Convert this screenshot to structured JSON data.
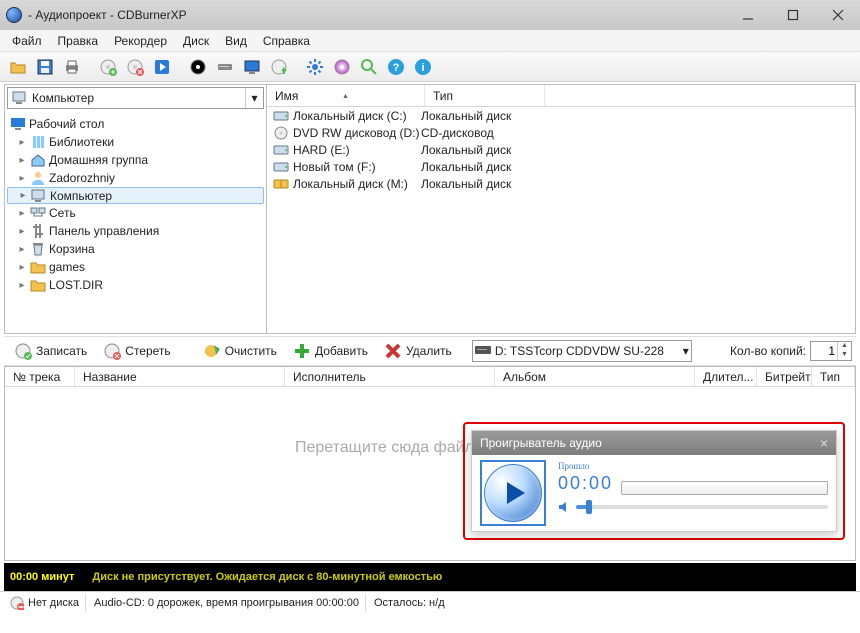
{
  "window": {
    "title": "- Аудиопроект - CDBurnerXP"
  },
  "menu": [
    "Файл",
    "Правка",
    "Рекордер",
    "Диск",
    "Вид",
    "Справка"
  ],
  "combo": {
    "label": "Компьютер"
  },
  "tree": {
    "root": "Рабочий стол",
    "items": [
      {
        "label": "Библиотеки",
        "kind": "lib"
      },
      {
        "label": "Домашняя группа",
        "kind": "home"
      },
      {
        "label": "Zadorozhniy",
        "kind": "user"
      },
      {
        "label": "Компьютер",
        "kind": "pc",
        "sel": true
      },
      {
        "label": "Сеть",
        "kind": "net"
      },
      {
        "label": "Панель управления",
        "kind": "cpl"
      },
      {
        "label": "Корзина",
        "kind": "bin"
      },
      {
        "label": "games",
        "kind": "folder"
      },
      {
        "label": "LOST.DIR",
        "kind": "folder"
      }
    ]
  },
  "fileCols": {
    "name": "Имя",
    "type": "Тип"
  },
  "files": [
    {
      "icon": "hdd",
      "name": "Локальный диск (C:)",
      "type": "Локальный диск"
    },
    {
      "icon": "dvd",
      "name": "DVD RW дисковод (D:)",
      "type": "CD-дисковод"
    },
    {
      "icon": "hdd",
      "name": "HARD (E:)",
      "type": "Локальный диск"
    },
    {
      "icon": "hdd",
      "name": "Новый том (F:)",
      "type": "Локальный диск"
    },
    {
      "icon": "zip",
      "name": "Локальный диск (M:)",
      "type": "Локальный диск"
    }
  ],
  "mid": {
    "burn": "Записать",
    "erase": "Стереть",
    "clear": "Очистить",
    "add": "Добавить",
    "del": "Удалить",
    "device": "D: TSSTcorp CDDVDW SU-228",
    "copies_label": "Кол-во копий:",
    "copies": "1"
  },
  "trackCols": [
    "№ трека",
    "Название",
    "Исполнитель",
    "Альбом",
    "Длител...",
    "Битрейт",
    "Тип"
  ],
  "placeholder": "Перетащите сюда файлы или испол",
  "player": {
    "title": "Проигрыватель аудио",
    "elapsed_label": "Прошло",
    "elapsed": "00:00"
  },
  "discbar": {
    "time": "00:00 минут",
    "msg": "Диск не присутствует. Ожидается диск с 80-минутной емкостью"
  },
  "status": {
    "nodisc": "Нет диска",
    "info": "Audio-CD: 0 дорожек, время проигрывания 00:00:00",
    "remain": "Осталось: н/д"
  }
}
